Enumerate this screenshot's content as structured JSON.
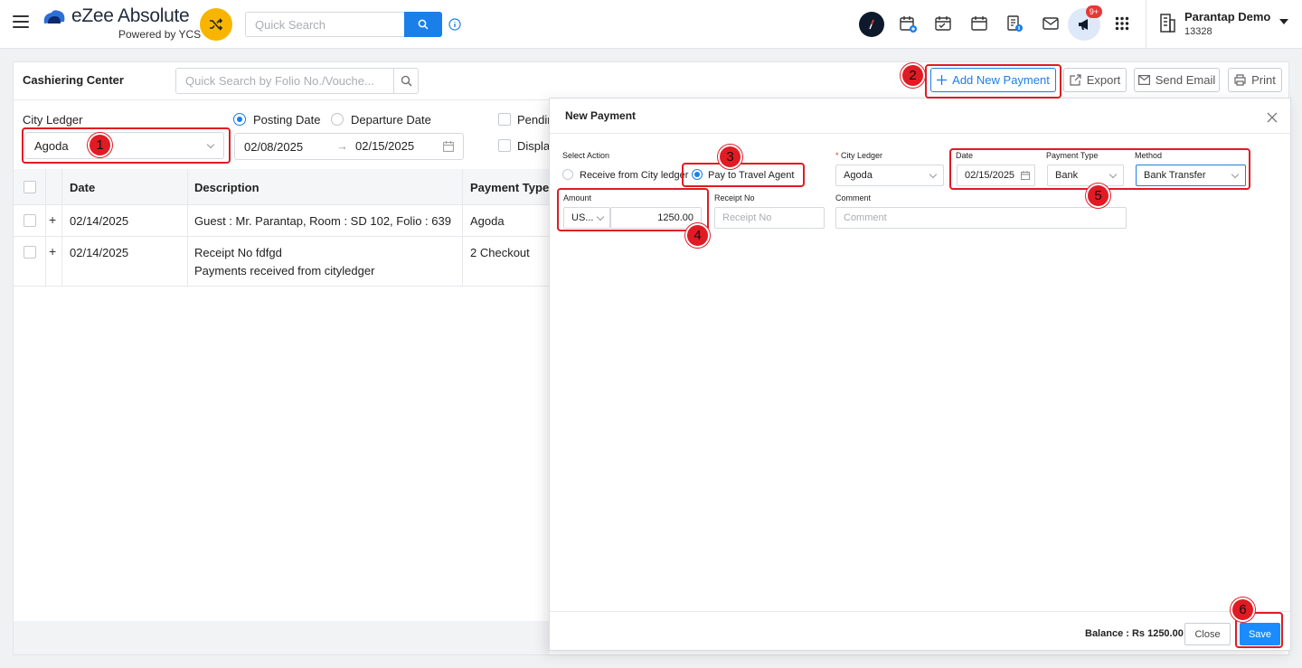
{
  "app": {
    "logo_title": "eZee Absolute",
    "logo_subtitle": "Powered by YCS",
    "quick_search_placeholder": "Quick Search",
    "notification_badge": "9+",
    "property_name": "Parantap Demo",
    "property_id": "13328"
  },
  "page": {
    "title": "Cashiering Center",
    "folio_search_placeholder": "Quick Search by Folio No./Vouche...",
    "actions": {
      "add_new_payment": "Add New Payment",
      "export": "Export",
      "send_email": "Send Email",
      "print": "Print"
    }
  },
  "filters": {
    "city_ledger_label": "City Ledger",
    "city_ledger_value": "Agoda",
    "date_mode_options": [
      "Posting Date",
      "Departure Date"
    ],
    "date_mode_selected": "Posting Date",
    "date_from": "02/08/2025",
    "date_to": "02/15/2025",
    "checkbox_1_label": "Pendin",
    "checkbox_2_label": "Displa"
  },
  "table": {
    "columns": [
      "Date",
      "Description",
      "Payment Type"
    ],
    "rows": [
      {
        "date": "02/14/2025",
        "description": "Guest : Mr. Parantap, Room : SD 102, Folio : 639",
        "description_2": "",
        "payment_type": "Agoda"
      },
      {
        "date": "02/14/2025",
        "description": "Receipt No fdfgd",
        "description_2": "Payments received from cityledger",
        "payment_type": "2 Checkout"
      }
    ]
  },
  "modal": {
    "title": "New Payment",
    "select_action_label": "Select Action",
    "action_options": [
      "Receive from City ledger",
      "Pay to Travel Agent"
    ],
    "action_selected": "Pay to Travel Agent",
    "city_ledger_label": "City Ledger",
    "city_ledger_value": "Agoda",
    "date_label": "Date",
    "date_value": "02/15/2025",
    "payment_type_label": "Payment Type",
    "payment_type_value": "Bank",
    "method_label": "Method",
    "method_value": "Bank Transfer",
    "amount_label": "Amount",
    "currency_value": "US...",
    "amount_value": "1250.00",
    "receipt_no_label": "Receipt No",
    "receipt_no_placeholder": "Receipt No",
    "comment_label": "Comment",
    "comment_placeholder": "Comment",
    "balance_text": "Balance : Rs 1250.00",
    "close_label": "Close",
    "save_label": "Save"
  },
  "annotations": {
    "step_1": "1",
    "step_2": "2",
    "step_3": "3",
    "step_4": "4",
    "step_5": "5",
    "step_6": "6"
  },
  "colors": {
    "primary": "#1a7fe8",
    "save_button": "#1a8cff",
    "annotation_red": "#e01b24",
    "shuffle_yellow": "#f7b500"
  }
}
